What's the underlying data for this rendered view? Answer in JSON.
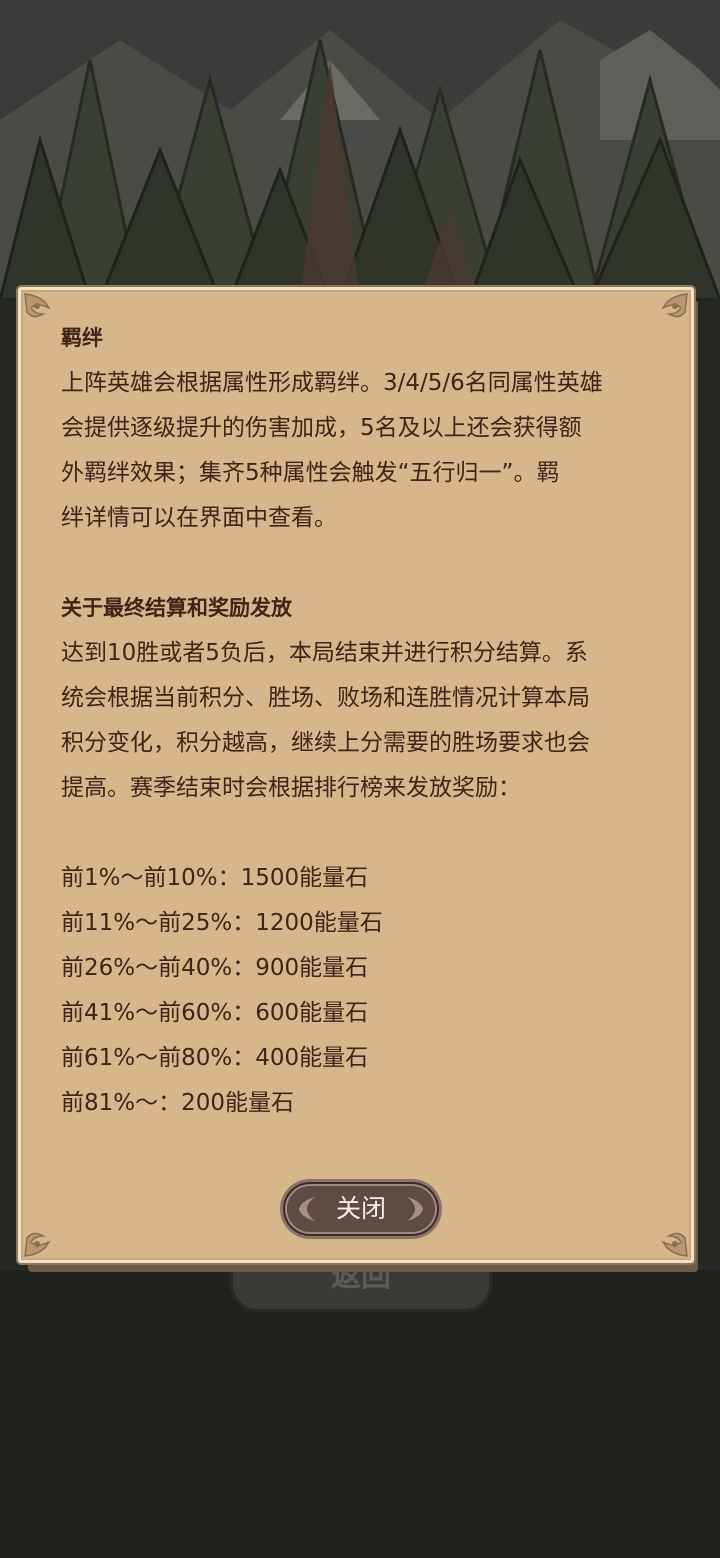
{
  "background": {
    "back_button_label": "返回"
  },
  "dialog": {
    "sections": [
      {
        "title": "羁绊",
        "lines": [
          "上阵英雄会根据属性形成羁绊。3/4/5/6名同属性英雄",
          "会提供逐级提升的伤害加成，5名及以上还会获得额",
          "外羁绊效果；集齐5种属性会触发“五行归一”。羁",
          "绊详情可以在界面中查看。"
        ]
      },
      {
        "title": "关于最终结算和奖励发放",
        "lines": [
          "达到10胜或者5负后，本局结束并进行积分结算。系",
          "统会根据当前积分、胜场、败场和连胜情况计算本局",
          "积分变化，积分越高，继续上分需要的胜场要求也会",
          "提高。赛季结束时会根据排行榜来发放奖励："
        ]
      }
    ],
    "rewards": [
      "前1%～前10%：1500能量石",
      "前11%～前25%：1200能量石",
      "前26%～前40%：900能量石",
      "前41%～前60%：600能量石",
      "前61%～前80%：400能量石",
      "前81%～：200能量石"
    ],
    "close_label": "关闭"
  },
  "colors": {
    "parchment": "#d6b78c",
    "text": "#3f2417",
    "button": "#5f4b43",
    "sky": "#3b3c39"
  }
}
